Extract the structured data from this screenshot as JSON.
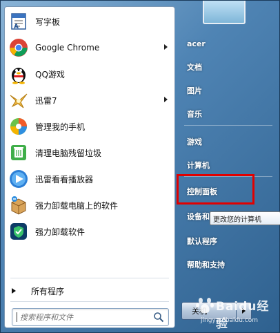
{
  "programs": [
    {
      "label": "写字板",
      "icon": "wordpad-icon",
      "submenu": false
    },
    {
      "label": "Google Chrome",
      "icon": "chrome-icon",
      "submenu": true
    },
    {
      "label": "QQ游戏",
      "icon": "qq-penguin-icon",
      "submenu": false
    },
    {
      "label": "迅雷7",
      "icon": "thunder-bird-icon",
      "submenu": true
    },
    {
      "label": "管理我的手机",
      "icon": "phone-manager-icon",
      "submenu": false
    },
    {
      "label": "清理电脑残留垃圾",
      "icon": "recycle-bin-icon",
      "submenu": false
    },
    {
      "label": "迅雷看看播放器",
      "icon": "player-icon",
      "submenu": false
    },
    {
      "label": "强力卸载电脑上的软件",
      "icon": "uninstall-box-icon",
      "submenu": false
    },
    {
      "label": "强力卸载软件",
      "icon": "shield-uninstall-icon",
      "submenu": false
    }
  ],
  "all_programs": "所有程序",
  "search": {
    "placeholder": "搜索程序和文件"
  },
  "right_menu": [
    {
      "label": "acer"
    },
    {
      "label": "文档"
    },
    {
      "label": "图片"
    },
    {
      "label": "音乐"
    },
    {
      "label": "游戏"
    },
    {
      "label": "计算机"
    },
    {
      "label": "控制面板"
    },
    {
      "label": "设备和"
    },
    {
      "label": "默认程序"
    },
    {
      "label": "帮助和支持"
    }
  ],
  "tooltip": "更改您的计算机",
  "shutdown": {
    "label": "关机"
  },
  "watermark": {
    "main": "Baidu经验",
    "sub": "jingyan.baidu.com"
  },
  "colors": {
    "highlight": "#e10000"
  }
}
